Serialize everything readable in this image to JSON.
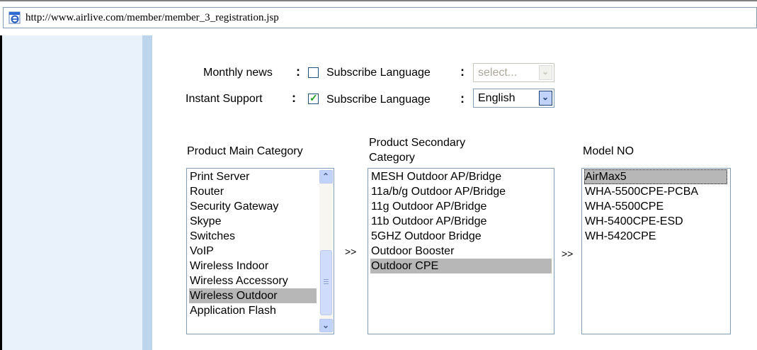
{
  "browser": {
    "address": "http://www.airlive.com/member/member_3_registration.jsp"
  },
  "form": {
    "monthly_news": {
      "label": "Monthly news",
      "colon": ":",
      "checked": false,
      "subscribe_label": "Subscribe Language",
      "lang_colon": ":",
      "language_value": "select...",
      "language_disabled": true
    },
    "instant_support": {
      "label": "Instant Support",
      "colon": ":",
      "checked": true,
      "subscribe_label": "Subscribe Language",
      "lang_colon": ":",
      "language_value": "English",
      "language_disabled": false
    }
  },
  "lists": {
    "main_category": {
      "header": "Product Main Category",
      "items": [
        "Print Server",
        "Router",
        "Security Gateway",
        "Skype",
        "Switches",
        "VoIP",
        "Wireless Indoor",
        "Wireless Accessory",
        "Wireless Outdoor",
        "Application Flash"
      ],
      "selected": "Wireless Outdoor"
    },
    "secondary_category": {
      "header_line1": "Product Secondary",
      "header_line2": "Category",
      "items": [
        "MESH Outdoor AP/Bridge",
        "11a/b/g Outdoor AP/Bridge",
        "11g Outdoor AP/Bridge",
        "11b Outdoor AP/Bridge",
        "5GHZ Outdoor Bridge",
        "Outdoor Booster",
        "Outdoor CPE"
      ],
      "selected": "Outdoor CPE"
    },
    "model_no": {
      "header": "Model NO",
      "items": [
        "AirMax5",
        "WHA-5500CPE-PCBA",
        "WHA-5500CPE",
        "WH-5400CPE-ESD",
        "WH-5420CPE"
      ],
      "selected": "AirMax5"
    },
    "arrow_1": ">>",
    "arrow_2": ">>"
  },
  "icons": {
    "address_icon": "ie-page-icon",
    "scroll_up": "chevron-up-icon",
    "scroll_down": "chevron-down-icon",
    "select_arrow": "chevron-down-icon"
  },
  "colors": {
    "left_panel": "#e9f1fa",
    "left_edge": "#bcd4ec",
    "selection": "#b7b7b7",
    "control_button": "#c1d3fb",
    "check": "#21a121"
  }
}
